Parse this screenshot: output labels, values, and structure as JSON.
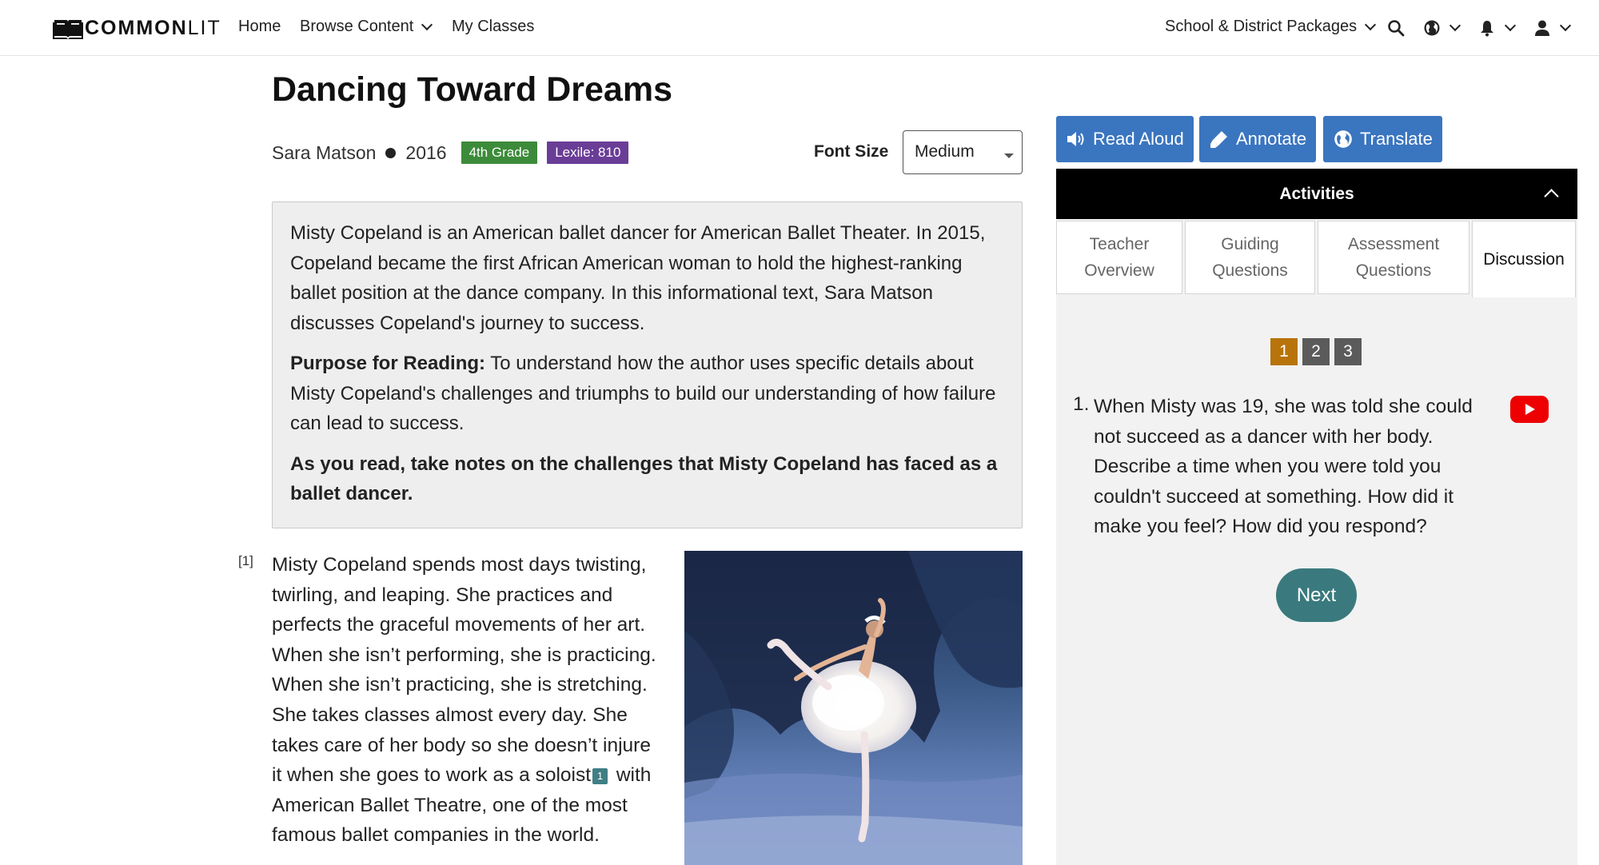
{
  "nav": {
    "logo_bold": "COMMON",
    "logo_light": "LIT",
    "home": "Home",
    "browse": "Browse Content",
    "classes": "My Classes",
    "packages": "School & District Packages",
    "icons": [
      "search-icon",
      "globe-icon",
      "bell-icon",
      "user-icon"
    ]
  },
  "article": {
    "title": "Dancing Toward Dreams",
    "author": "Sara Matson",
    "year": "2016",
    "grade": "4th Grade",
    "lexile": "Lexile: 810",
    "font_size_label": "Font Size",
    "font_size_value": "Medium",
    "intro": "Misty Copeland is an American ballet dancer for American Ballet Theater. In 2015, Copeland became the first African American woman to hold the highest-ranking ballet position at the dance company. In this informational text, Sara Matson discusses Copeland's journey to success.",
    "purpose_label": "Purpose for Reading:",
    "purpose_text": " To understand how the author uses specific details about Misty Copeland's challenges and triumphs to build our understanding of how failure can lead to success.",
    "instruction": "As you read, take notes on the challenges that Misty Copeland has faced as a ballet dancer.",
    "paragraph_number": "[1]",
    "paragraph_part1": "Misty Copeland spends most days twisting, twirling, and leaping. She practices and perfects the graceful movements of her art. When she isn’t performing, she is practicing. When she isn’t practicing, she is stretching. She takes classes almost every day. She takes care of her body so she doesn’t injure it when she goes to work as a soloist",
    "footnote": "1",
    "paragraph_part2": " with American Ballet Theatre, one of the most famous ballet companies in the world."
  },
  "tools": {
    "read_aloud": "Read Aloud",
    "annotate": "Annotate",
    "translate": "Translate"
  },
  "activities": {
    "header": "Activities",
    "tabs": [
      {
        "line1": "Teacher",
        "line2": "Overview"
      },
      {
        "line1": "Guiding",
        "line2": "Questions"
      },
      {
        "line1": "Assessment",
        "line2": "Questions"
      },
      {
        "line1": "Discussion",
        "line2": ""
      }
    ],
    "pages": [
      "1",
      "2",
      "3"
    ],
    "question_number": "1.",
    "question": "When Misty was 19, she was told she could not succeed as a dancer with her body. Describe a time when you were told you couldn't succeed at something. How did it make you feel? How did you respond?",
    "next": "Next"
  },
  "colors": {
    "tool_blue": "#3a75c0",
    "grade_green": "#3c8b3a",
    "lexile_purple": "#6a3d97",
    "page_current": "#b8740a",
    "next_teal": "#3a7a7e"
  }
}
